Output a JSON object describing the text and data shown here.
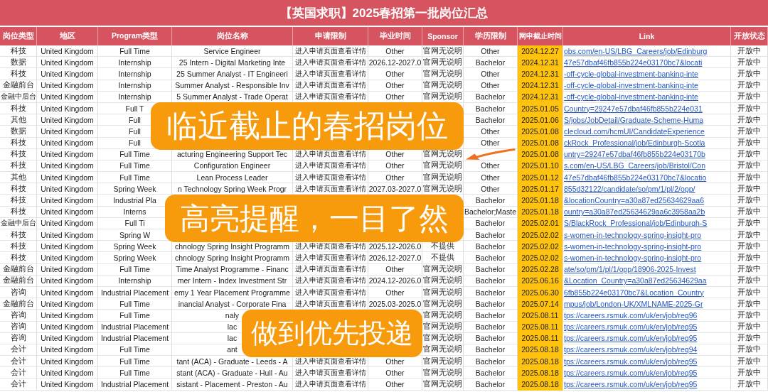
{
  "title": "【英国求职】2025春招第一批岗位汇总",
  "columns": [
    {
      "label": "岗位类型"
    },
    {
      "label": "地区"
    },
    {
      "label": "Program类型"
    },
    {
      "label": "岗位名称"
    },
    {
      "label": "申请限制"
    },
    {
      "label": "毕业时间"
    },
    {
      "label": "Sponsor"
    },
    {
      "label": "学历限制"
    },
    {
      "label": "网申截止时间",
      "kind": "highlight"
    },
    {
      "label": "Link",
      "kind": "link"
    },
    {
      "label": "开放状态"
    }
  ],
  "rows": [
    [
      "科技",
      "United Kingdom",
      "Full Time",
      "Service Engineer",
      "进入申请页面查看详情",
      "Other",
      "官网无说明",
      "Other",
      "2024.12.27",
      "obs.com/en-US/LBG_Careers/job/Edinburg",
      "开放中"
    ],
    [
      "数据",
      "United Kingdom",
      "Internship",
      "25 Intern - Digital Marketing Inte",
      "进入申请页面查看详情",
      "2026.12-2027.0",
      "官网无说明",
      "Bachelor",
      "2024.12.31",
      "47e57dbaf46fb855b224e03170bc7&locati",
      "开放中"
    ],
    [
      "科技",
      "United Kingdom",
      "Internship",
      "25 Summer Analyst - IT Engineeri",
      "进入申请页面查看详情",
      "Other",
      "官网无说明",
      "Other",
      "2024.12.31",
      "-off-cycle-global-investment-banking-inte",
      "开放中"
    ],
    [
      "金融前台",
      "United Kingdom",
      "Internship",
      "Summer Analyst - Responsible Inv",
      "进入申请页面查看详情",
      "Other",
      "官网无说明",
      "Other",
      "2024.12.31",
      "-off-cycle-global-investment-banking-inte",
      "开放中"
    ],
    [
      "金融中后台",
      "United Kingdom",
      "Internship",
      "5 Summer Analyst - Trade Operat",
      "进入申请页面查看详情",
      "Other",
      "官网无说明",
      "Bachelor",
      "2024.12.31",
      "-off-cycle-global-investment-banking-inte",
      "开放中"
    ],
    [
      "科技",
      "United Kingdom",
      "Full T",
      null,
      null,
      null,
      null,
      "Bachelor",
      "2025.01.05",
      "Country=29247e57dbaf46fb855b224e031",
      "开放中"
    ],
    [
      "其他",
      "United Kingdom",
      "Full",
      null,
      null,
      null,
      null,
      "Bachelor",
      "2025.01.06",
      "S/jobs/JobDetail/Graduate-Scheme-Huma",
      "开放中"
    ],
    [
      "数据",
      "United Kingdom",
      "Full",
      null,
      null,
      null,
      null,
      "Other",
      "2025.01.08",
      "clecloud.com/hcmUI/CandidateExperience",
      "开放中"
    ],
    [
      "科技",
      "United Kingdom",
      "Full",
      null,
      null,
      null,
      null,
      "Other",
      "2025.01.08",
      "ckRock_Professional/job/Edinburgh-Scotla",
      "开放中"
    ],
    [
      "科技",
      "United Kingdom",
      "Full Time",
      "acturing Engineering Support Tec",
      "进入申请页面查看详情",
      "Other",
      "官网无说明",
      null,
      "2025.01.08",
      "untry=29247e57dbaf46fb855b224e03170b",
      "开放中"
    ],
    [
      "科技",
      "United Kingdom",
      "Full Time",
      "Configuration Engineer",
      "进入申请页面查看详情",
      "Other",
      "官网无说明",
      "Other",
      "2025.01.10",
      "s.com/en-US/LBG_Careers/job/Bristol/Con",
      "开放中"
    ],
    [
      "其他",
      "United Kingdom",
      "Full Time",
      "Lean Process Leader",
      "进入申请页面查看详情",
      "Other",
      "官网无说明",
      "Other",
      "2025.01.12",
      "47e57dbaf46fb855b224e03170bc7&locatio",
      "开放中"
    ],
    [
      "科技",
      "United Kingdom",
      "Spring Week",
      "n Technology Spring Week Progr",
      "进入申请页面查看详情",
      "2027.03-2027.0",
      "官网无说明",
      "Other",
      "2025.01.17",
      "855d32122/candidate/so/pm/1/pl/2/opp/",
      "开放中"
    ],
    [
      "科技",
      "United Kingdom",
      "Industrial Pla",
      null,
      null,
      null,
      null,
      "Bachelor",
      "2025.01.18",
      "&locationCountry=a30a87ed25634629aa6",
      "开放中"
    ],
    [
      "科技",
      "United Kingdom",
      "Interns",
      null,
      null,
      null,
      null,
      "Bachelor;Maste",
      "2025.01.18",
      "ountry=a30a87ed25634629aa6c3958aa2b",
      "开放中"
    ],
    [
      "金融中后台",
      "United Kingdom",
      "Full Ti",
      null,
      null,
      null,
      null,
      "Bachelor",
      "2025.02.01",
      "S/BlackRock_Professional/job/Edinburgh-S",
      "开放中"
    ],
    [
      "科技",
      "United Kingdom",
      "Spring W",
      null,
      null,
      null,
      null,
      "Bachelor",
      "2025.02.02",
      "s-women-in-technology-spring-insight-pro",
      "开放中"
    ],
    [
      "科技",
      "United Kingdom",
      "Spring Week",
      "chnology Spring Insight Programm",
      "进入申请页面查看详情",
      "2025.12-2026.0",
      "不提供",
      "Bachelor",
      "2025.02.02",
      "s-women-in-technology-spring-insight-pro",
      "开放中"
    ],
    [
      "科技",
      "United Kingdom",
      "Spring Week",
      "chnology Spring Insight Programm",
      "进入申请页面查看详情",
      "2026.12-2027.0",
      "不提供",
      "Bachelor",
      "2025.02.02",
      "s-women-in-technology-spring-insight-pro",
      "开放中"
    ],
    [
      "金融前台",
      "United Kingdom",
      "Full Time",
      "Time Analyst Programme - Financ",
      "进入申请页面查看详情",
      "Other",
      "官网无说明",
      "Bachelor",
      "2025.02.28",
      "ate/so/pm/1/pl/1/opp/18906-2025-Invest",
      "开放中"
    ],
    [
      "金融前台",
      "United Kingdom",
      "Internship",
      "mer Intern - Index Investment Str",
      "进入申请页面查看详情",
      "2024.12-2026.0",
      "官网无说明",
      "Bachelor",
      "2025.06.16",
      "&Location_Country=a30a87ed25634629aa",
      "开放中"
    ],
    [
      "咨询",
      "United Kingdom",
      "Industrial Placement",
      "emy 1 Year Placement Programme",
      "进入申请页面查看详情",
      "Other",
      "官网无说明",
      "Bachelor",
      "2025.06.30",
      "6fb855b224e03170bc7&Location_Country",
      "开放中"
    ],
    [
      "金融前台",
      "United Kingdom",
      "Full Time",
      "inancial Analyst - Corporate Fina",
      "进入申请页面查看详情",
      "2025.03-2025.0",
      "官网无说明",
      "Bachelor",
      "2025.07.14",
      "mpus/job/London-UK/XMLNAME-2025-Gr",
      "开放中"
    ],
    [
      "咨询",
      "United Kingdom",
      "Full Time",
      "naly",
      null,
      null,
      "官网无说明",
      "Bachelor",
      "2025.08.11",
      "tps://careers.rsmuk.com/uk/en/job/req96",
      "开放中"
    ],
    [
      "咨询",
      "United Kingdom",
      "Industrial Placement",
      "lac",
      null,
      null,
      "官网无说明",
      "Bachelor",
      "2025.08.11",
      "tps://careers.rsmuk.com/uk/en/job/req95",
      "开放中"
    ],
    [
      "咨询",
      "United Kingdom",
      "Industrial Placement",
      "lac",
      null,
      null,
      "官网无说明",
      "Bachelor",
      "2025.08.11",
      "tps://careers.rsmuk.com/uk/en/job/req95",
      "开放中"
    ],
    [
      "会计",
      "United Kingdom",
      "Full Time",
      "ant",
      null,
      null,
      "官网无说明",
      "Bachelor",
      "2025.08.18",
      "tps://careers.rsmuk.com/uk/en/job/req94",
      "开放中"
    ],
    [
      "会计",
      "United Kingdom",
      "Full Time",
      "tant (ACA) - Graduate - Leeds - A",
      "进入申请页面查看详情",
      "Other",
      "官网无说明",
      "Bachelor",
      "2025.08.18",
      "tps://careers.rsmuk.com/uk/en/job/req95",
      "开放中"
    ],
    [
      "会计",
      "United Kingdom",
      "Full Time",
      "stant (ACA) - Graduate - Hull - Au",
      "进入申请页面查看详情",
      "Other",
      "官网无说明",
      "Bachelor",
      "2025.08.18",
      "tps://careers.rsmuk.com/uk/en/job/req95",
      "开放中"
    ],
    [
      "会计",
      "United Kingdom",
      "Industrial Placement",
      "sistant - Placement - Preston - Au",
      "进入申请页面查看详情",
      "Other",
      "官网无说明",
      "Bachelor",
      "2025.08.18",
      "tps://careers.rsmuk.com/uk/en/job/req95",
      "开放中"
    ]
  ],
  "callouts": [
    "临近截止的春招岗位",
    "高亮提醒，一目了然",
    "做到优先投递"
  ]
}
